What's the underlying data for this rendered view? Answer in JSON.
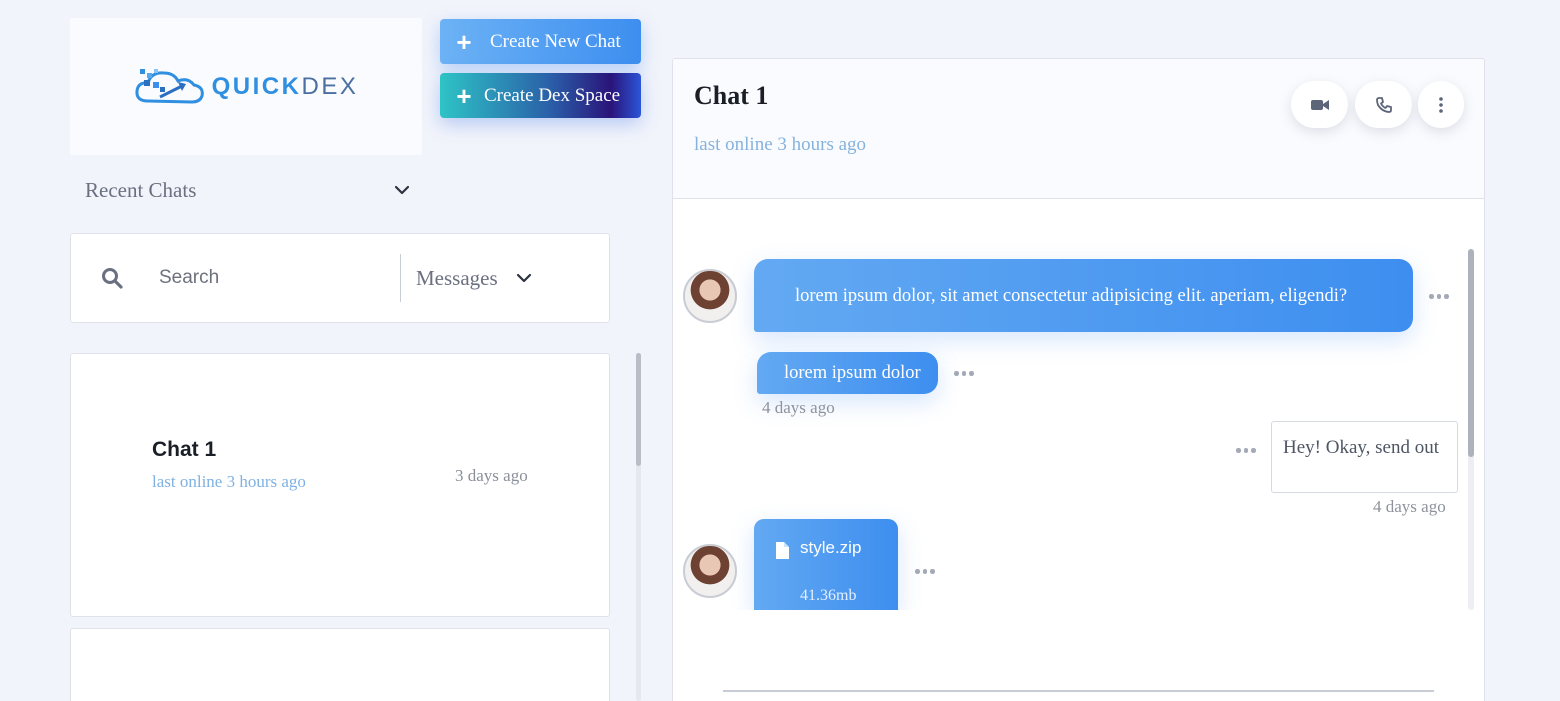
{
  "brand": {
    "word_bold": "QUICK",
    "word_light": "DEX"
  },
  "actions": {
    "create_chat": "Create New Chat",
    "create_space": "Create Dex Space",
    "plus_icon": "plus-icon"
  },
  "sidebar": {
    "recent_label": "Recent Chats",
    "search_placeholder": "Search",
    "filter_selected": "Messages",
    "chats": [
      {
        "name": "Chat 1",
        "status": "last online 3 hours ago",
        "time": "3 days ago"
      }
    ]
  },
  "conversation": {
    "title": "Chat 1",
    "status": "last online 3 hours ago",
    "header_icons": [
      "video-camera-icon",
      "phone-icon",
      "more-vertical-icon"
    ],
    "messages": [
      {
        "direction": "in",
        "text": "lorem ipsum dolor, sit amet consectetur adipisicing elit. aperiam, eligendi?"
      },
      {
        "direction": "in",
        "text": "lorem ipsum dolor",
        "time": "4 days ago"
      },
      {
        "direction": "out",
        "text": "Hey! Okay, send out",
        "time": "4 days ago"
      },
      {
        "direction": "in",
        "type": "file",
        "filename": "style.zip",
        "size": "41.36mb"
      }
    ]
  },
  "colors": {
    "accent": "#3d8ef0",
    "muted_link": "#86b2de",
    "background": "#f2f4fb"
  }
}
